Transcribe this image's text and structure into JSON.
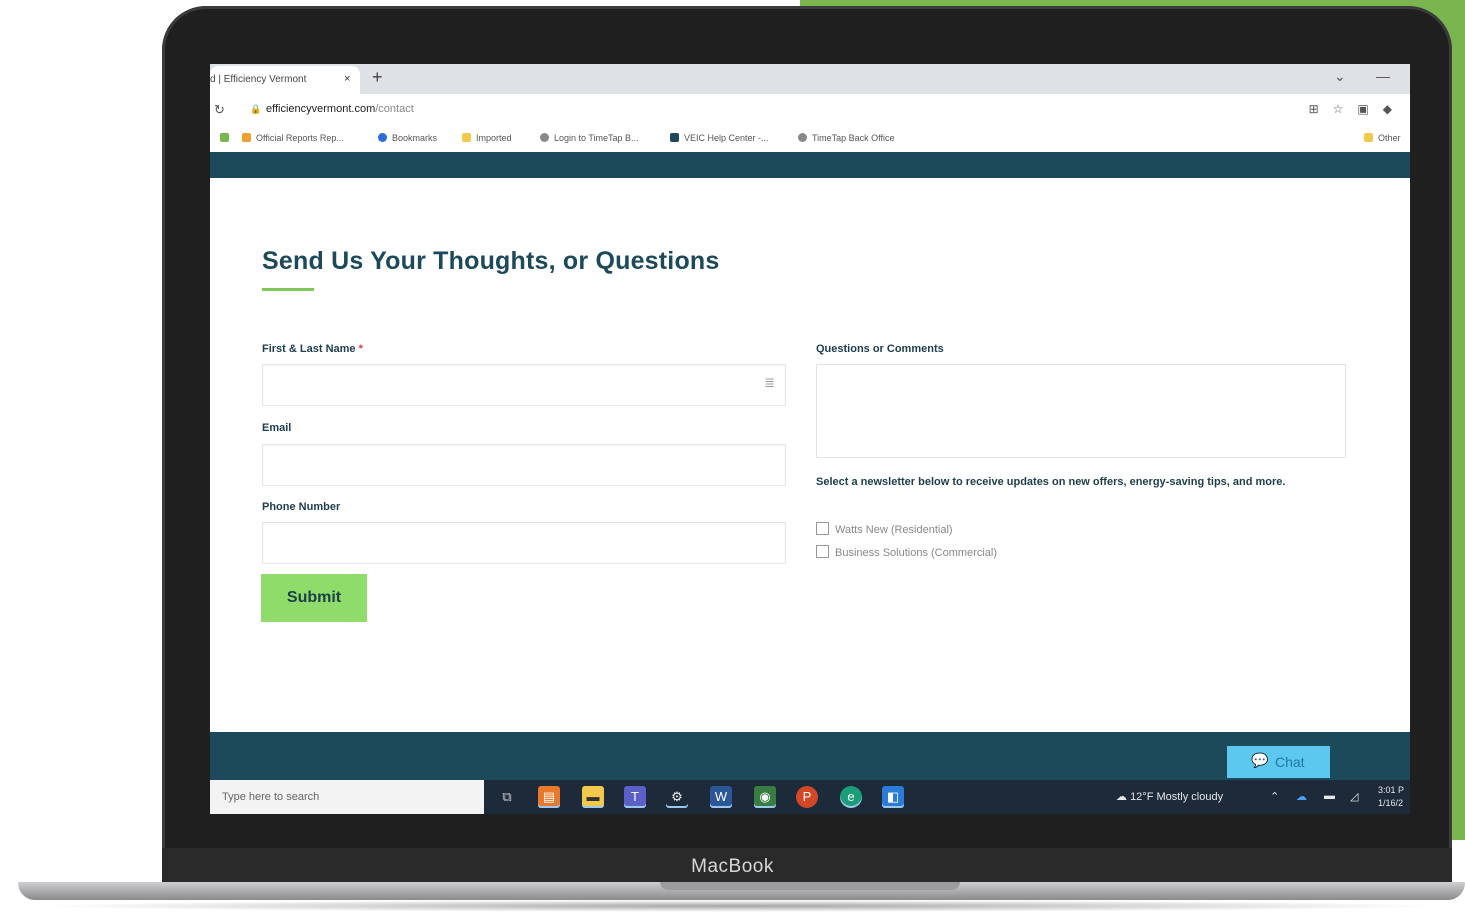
{
  "device": {
    "brand": "MacBook"
  },
  "browser": {
    "tab_title": "d | Efficiency Vermont",
    "tab_close": "×",
    "new_tab": "+",
    "url_domain": "efficiencyvermont.com",
    "url_path": "/contact",
    "bookmarks": [
      "Official Reports Rep...",
      "Bookmarks",
      "Imported",
      "Login to TimeTap B...",
      "VEIC Help Center -...",
      "TimeTap Back Office",
      "Other"
    ]
  },
  "page": {
    "heading": "Send Us Your Thoughts, or Questions",
    "name_label": "First & Last Name",
    "required_mark": "*",
    "email_label": "Email",
    "phone_label": "Phone Number",
    "submit_label": "Submit",
    "comments_label": "Questions or Comments",
    "newsletter_text": "Select a newsletter below to receive updates on new offers, energy-saving tips, and more.",
    "newsletters": [
      {
        "label": "Watts New (Residential)",
        "checked": false
      },
      {
        "label": "Business Solutions (Commercial)",
        "checked": false
      }
    ],
    "chat_label": "Chat"
  },
  "taskbar": {
    "search_placeholder": "Type here to search",
    "weather": "12°F  Mostly cloudy",
    "time": "3:01 P",
    "date": "1/16/2"
  },
  "colors": {
    "brand_dark": "#1d4a5a",
    "accent_green": "#7ec95a",
    "submit_green": "#8fdc6a",
    "chat_blue": "#5cc8f0"
  }
}
